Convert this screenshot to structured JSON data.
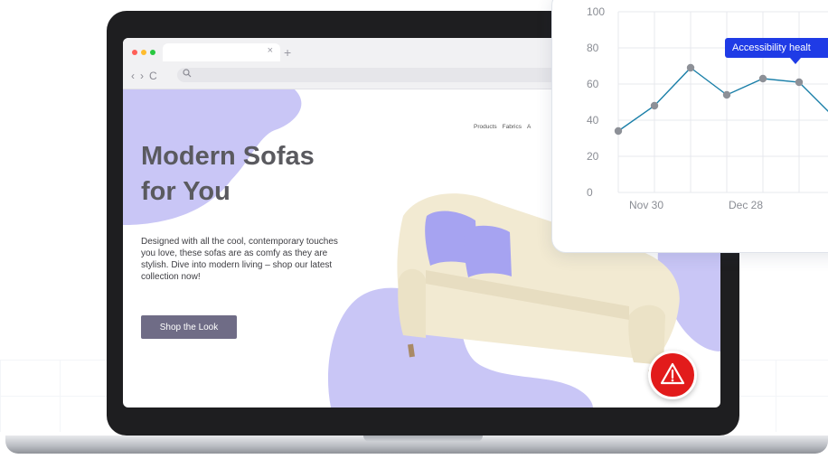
{
  "browser": {
    "tab_close": "×",
    "tab_new": "+",
    "nav_back": "‹",
    "nav_forward": "›",
    "nav_reload": "C",
    "search_icon": "search-icon",
    "traffic_lights": [
      "#ff5f57",
      "#febc2e",
      "#28c840"
    ]
  },
  "site": {
    "nav_items": [
      "Products",
      "Fabrics",
      "A"
    ],
    "hero_title_line1": "Modern Sofas",
    "hero_title_line2": "for You",
    "description": "Designed with all the cool, contemporary touches you love, these sofas are as comfy as they are stylish. Dive into modern living – shop our latest collection now!",
    "cta_label": "Shop the Look",
    "accent_blob_color": "#c9c6f6"
  },
  "alert": {
    "icon": "warning-triangle-icon",
    "color": "#e21b1b"
  },
  "chart_data": {
    "type": "line",
    "x": [
      "",
      "",
      "Nov 30",
      "",
      "",
      "Dec 28",
      "",
      ""
    ],
    "values": [
      34,
      48,
      69,
      54,
      63,
      61,
      41
    ],
    "x_tick_labels": [
      "Nov 30",
      "Dec 28"
    ],
    "y_ticks": [
      "100",
      "80",
      "60",
      "40",
      "20",
      "0"
    ],
    "ylim": [
      0,
      100
    ],
    "grid": true,
    "tooltip": "Accessibility healt",
    "line_color": "#1a7fa8",
    "point_color": "#8d9097"
  }
}
